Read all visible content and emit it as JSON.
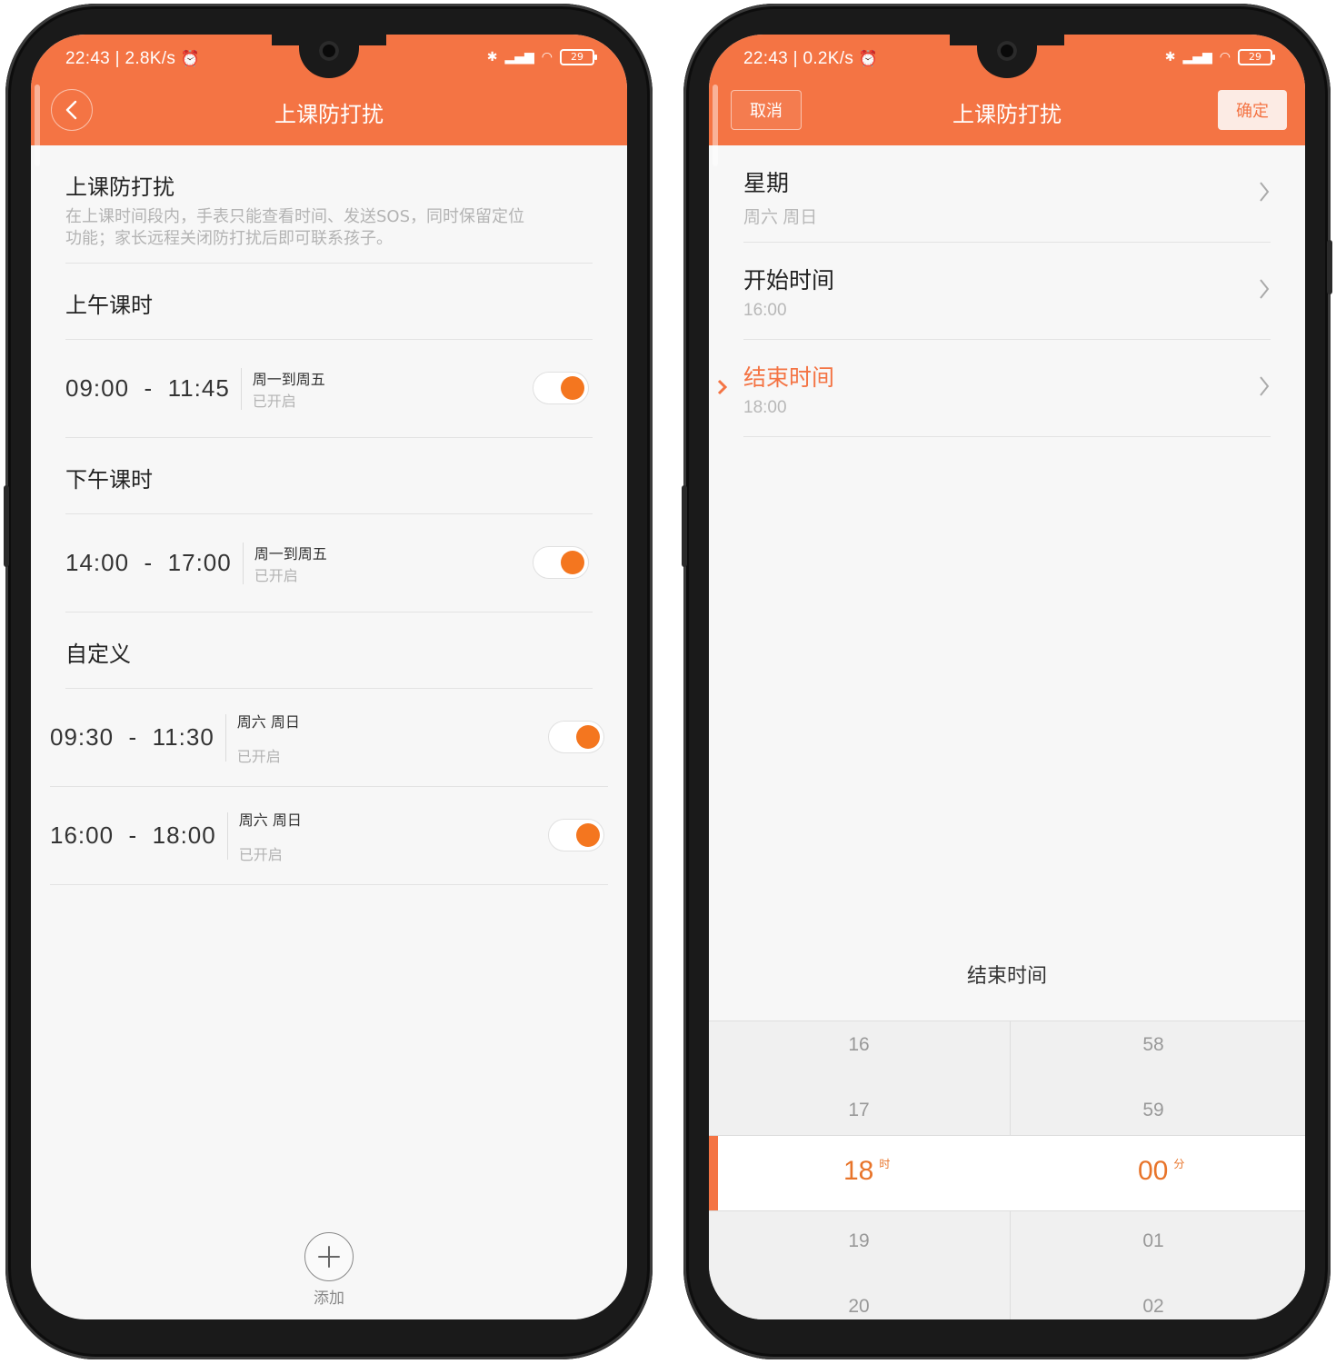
{
  "accent": "#f47444",
  "toggle_color": "#f4761f",
  "left": {
    "status": {
      "time": "22:43",
      "speed": "2.8K/s",
      "battery": "29"
    },
    "title": "上课防打扰",
    "header": {
      "title": "上课防打扰",
      "desc_line1": "在上课时间段内，手表只能查看时间、发送SOS，同时保留定位",
      "desc_line2": "功能；家长远程关闭防打扰后即可联系孩子。"
    },
    "sections": {
      "morning": "上午课时",
      "afternoon": "下午课时",
      "custom": "自定义"
    },
    "schedules": [
      {
        "start": "09:00",
        "end": "11:45",
        "days": "周一到周五",
        "state": "已开启",
        "enabled": true
      },
      {
        "start": "14:00",
        "end": "17:00",
        "days": "周一到周五",
        "state": "已开启",
        "enabled": true
      },
      {
        "start": "09:30",
        "end": "11:30",
        "days": "周六 周日",
        "state": "已开启",
        "enabled": true
      },
      {
        "start": "16:00",
        "end": "18:00",
        "days": "周六 周日",
        "state": "已开启",
        "enabled": true
      }
    ],
    "sep": "-",
    "add_label": "添加"
  },
  "right": {
    "status": {
      "time": "22:43",
      "speed": "0.2K/s",
      "battery": "29"
    },
    "title": "上课防打扰",
    "cancel_label": "取消",
    "ok_label": "确定",
    "settings": [
      {
        "label": "星期",
        "value": "周六 周日"
      },
      {
        "label": "开始时间",
        "value": "16:00"
      },
      {
        "label": "结束时间",
        "value": "18:00"
      }
    ],
    "picker": {
      "title": "结束时间",
      "hours": [
        "16",
        "17",
        "18",
        "19",
        "20"
      ],
      "minutes": [
        "58",
        "59",
        "00",
        "01",
        "02"
      ],
      "hour_unit": "时",
      "minute_unit": "分"
    }
  }
}
